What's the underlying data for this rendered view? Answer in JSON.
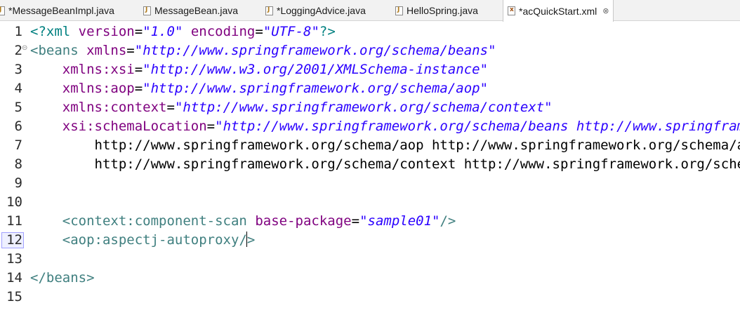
{
  "tabs": [
    {
      "label": "*MessageBeanImpl.java",
      "icon": "java-file-icon"
    },
    {
      "label": "MessageBean.java",
      "icon": "java-file-icon"
    },
    {
      "label": "*LoggingAdvice.java",
      "icon": "java-file-icon"
    },
    {
      "label": "HelloSpring.java",
      "icon": "java-file-icon"
    },
    {
      "label": "*acQuickStart.xml",
      "icon": "xml-file-icon",
      "active": true,
      "close": "⊗"
    }
  ],
  "editor": {
    "current_line": 12,
    "lines": [
      {
        "num": "1",
        "code": "<?xml version=\"1.0\" encoding=\"UTF-8\"?>"
      },
      {
        "num": "2",
        "code": "<beans xmlns=\"http://www.springframework.org/schema/beans\""
      },
      {
        "num": "3",
        "code": "    xmlns:xsi=\"http://www.w3.org/2001/XMLSchema-instance\""
      },
      {
        "num": "4",
        "code": "    xmlns:aop=\"http://www.springframework.org/schema/aop\""
      },
      {
        "num": "5",
        "code": "    xmlns:context=\"http://www.springframework.org/schema/context\""
      },
      {
        "num": "6",
        "code": "    xsi:schemaLocation=\"http://www.springframework.org/schema/beans http://www.springframework.org/schema/beans/spring-beans.xsd"
      },
      {
        "num": "7",
        "code": "        http://www.springframework.org/schema/aop http://www.springframework.org/schema/aop/spring-aop.xsd"
      },
      {
        "num": "8",
        "code": "        http://www.springframework.org/schema/context http://www.springframework.org/schema/context/spring-context.xsd\">"
      },
      {
        "num": "9",
        "code": ""
      },
      {
        "num": "10",
        "code": ""
      },
      {
        "num": "11",
        "code": "    <context:component-scan base-package=\"sample01\"/>"
      },
      {
        "num": "12",
        "code": "    <aop:aspectj-autoproxy/>"
      },
      {
        "num": "13",
        "code": ""
      },
      {
        "num": "14",
        "code": "</beans>"
      },
      {
        "num": "15",
        "code": ""
      }
    ]
  },
  "colors": {
    "tag": "#3f7f7f",
    "attribute": "#7f007f",
    "value": "#2a00ff",
    "processing_instruction": "#008080"
  }
}
